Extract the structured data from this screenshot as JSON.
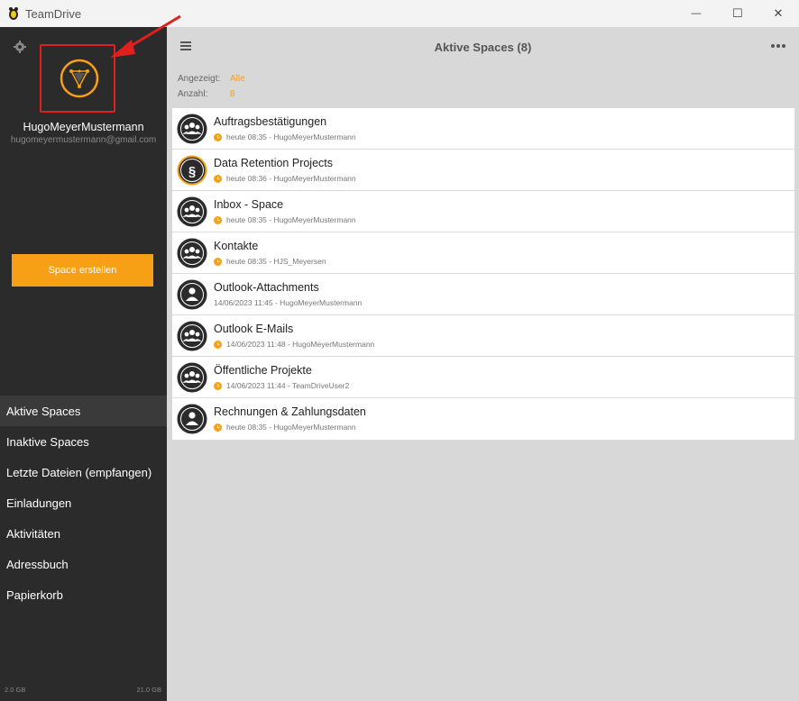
{
  "window": {
    "title": "TeamDrive",
    "minimize_symbol": "—",
    "maximize_symbol": "☐",
    "close_symbol": "✕"
  },
  "sidebar": {
    "username": "HugoMeyerMustermann",
    "email": "hugomeyermustermann@gmail.com",
    "create_button": "Space erstellen",
    "nav": [
      {
        "label": "Aktive Spaces",
        "active": true
      },
      {
        "label": "Inaktive Spaces",
        "active": false
      },
      {
        "label": "Letzte Dateien (empfangen)",
        "active": false
      },
      {
        "label": "Einladungen",
        "active": false
      },
      {
        "label": "Aktivitäten",
        "active": false
      },
      {
        "label": "Adressbuch",
        "active": false
      },
      {
        "label": "Papierkorb",
        "active": false
      }
    ],
    "storage_used": "2.0 GB",
    "storage_total": "21.0 GB"
  },
  "main": {
    "title": "Aktive Spaces (8)",
    "filter_label": "Angezeigt:",
    "filter_value": "Alle",
    "count_label": "Anzahl:",
    "count_value": "8",
    "spaces": [
      {
        "name": "Auftragsbestätigungen",
        "meta": "heute 08:35 - HugoMeyerMustermann",
        "icon": "group-icon",
        "dot": true,
        "highlight": false
      },
      {
        "name": "Data Retention Projects",
        "meta": "heute 08:36 - HugoMeyerMustermann",
        "icon": "paragraph-icon",
        "dot": true,
        "highlight": true
      },
      {
        "name": "Inbox - Space",
        "meta": "heute 08:35 - HugoMeyerMustermann",
        "icon": "group-icon",
        "dot": true,
        "highlight": false
      },
      {
        "name": "Kontakte",
        "meta": "heute 08:35 - HJS_Meyersen",
        "icon": "group-icon",
        "dot": true,
        "highlight": false
      },
      {
        "name": "Outlook-Attachments",
        "meta": "14/06/2023 11:45 - HugoMeyerMustermann",
        "icon": "person-icon",
        "dot": false,
        "highlight": false
      },
      {
        "name": "Outlook E-Mails",
        "meta": "14/06/2023 11:48 - HugoMeyerMustermann",
        "icon": "group-icon",
        "dot": true,
        "highlight": false
      },
      {
        "name": "Öffentliche Projekte",
        "meta": "14/06/2023 11:44 - TeamDriveUser2",
        "icon": "group-icon",
        "dot": true,
        "highlight": false
      },
      {
        "name": "Rechnungen & Zahlungsdaten",
        "meta": "heute 08:35 - HugoMeyerMustermann",
        "icon": "person-icon",
        "dot": true,
        "highlight": false
      }
    ]
  },
  "colors": {
    "accent": "#f7a016",
    "sidebar_bg": "#2b2b2b",
    "main_bg": "#d8d8d8",
    "annotation_red": "#e0201e"
  }
}
